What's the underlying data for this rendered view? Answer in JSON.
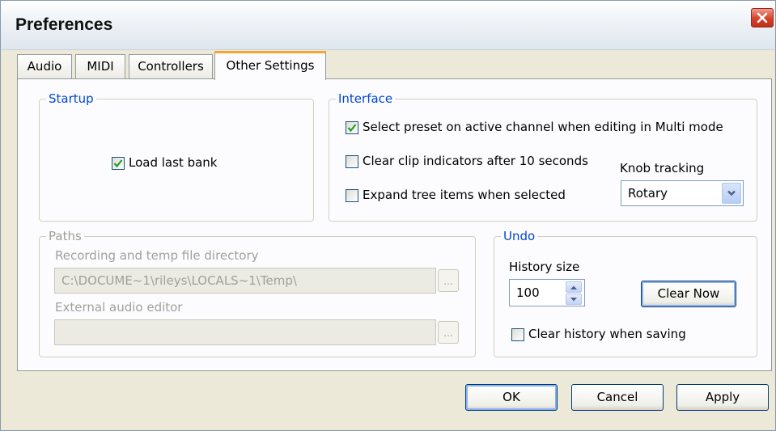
{
  "window": {
    "title": "Preferences"
  },
  "tabs": [
    {
      "label": "Audio",
      "active": false
    },
    {
      "label": "MIDI",
      "active": false
    },
    {
      "label": "Controllers",
      "active": false
    },
    {
      "label": "Other Settings",
      "active": true
    }
  ],
  "startup": {
    "legend": "Startup",
    "load_last_bank": {
      "label": "Load last bank",
      "checked": true
    }
  },
  "interface": {
    "legend": "Interface",
    "select_preset": {
      "label": "Select preset on active channel when editing in Multi mode",
      "checked": true
    },
    "clear_clip": {
      "label": "Clear clip indicators after 10 seconds",
      "checked": false
    },
    "expand_tree": {
      "label": "Expand tree items when selected",
      "checked": false
    },
    "knob_tracking": {
      "label": "Knob tracking",
      "value": "Rotary"
    }
  },
  "paths": {
    "legend": "Paths",
    "recording_dir": {
      "label": "Recording and temp file directory",
      "value": "C:\\DOCUME~1\\rileys\\LOCALS~1\\Temp\\"
    },
    "external_editor": {
      "label": "External audio editor",
      "value": ""
    },
    "browse_label": "..."
  },
  "undo": {
    "legend": "Undo",
    "history_size": {
      "label": "History size",
      "value": "100"
    },
    "clear_now_label": "Clear Now",
    "clear_on_save": {
      "label": "Clear history when saving",
      "checked": false
    }
  },
  "footer": {
    "ok_label": "OK",
    "cancel_label": "Cancel",
    "apply_label": "Apply"
  },
  "colors": {
    "legend_blue": "#0046d5",
    "tab_accent": "#f7a834",
    "dialog_bg": "#ece9d8",
    "close_red": "#d6402a"
  }
}
